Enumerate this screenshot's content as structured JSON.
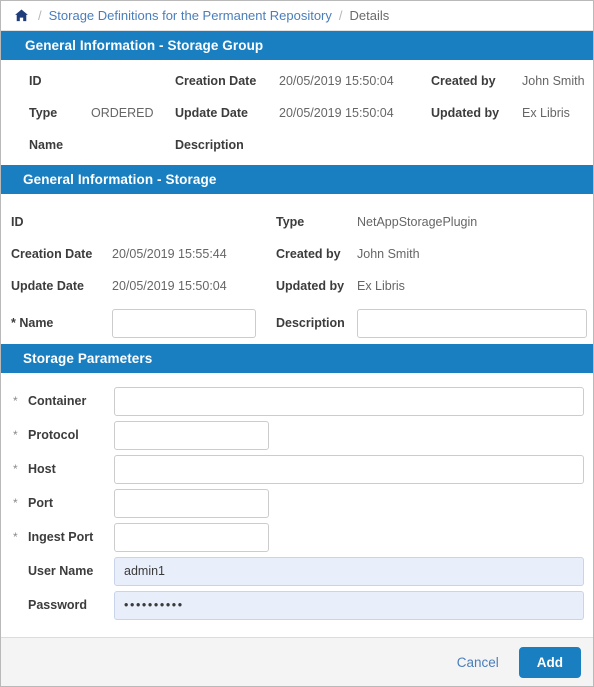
{
  "breadcrumb": {
    "home_icon": "home-icon",
    "separator": "/",
    "items": [
      {
        "label": "Storage Definitions for the Permanent Repository",
        "current": false
      },
      {
        "label": "Details",
        "current": true
      }
    ]
  },
  "colors": {
    "accent": "#1a7fc1",
    "link": "#4a7ebb",
    "filled_input_bg": "#e9eefb",
    "footer_bg": "#f4f4f4"
  },
  "sections": {
    "storage_group": {
      "title": "General Information - Storage Group",
      "rows": [
        {
          "col1_label": "ID",
          "col1_value": "",
          "col2_label": "Creation Date",
          "col2_value": "20/05/2019 15:50:04",
          "col3_label": "Created by",
          "col3_value": "John Smith"
        },
        {
          "col1_label": "Type",
          "col1_value": "ORDERED",
          "col2_label": "Update Date",
          "col2_value": "20/05/2019 15:50:04",
          "col3_label": "Updated by",
          "col3_value": "Ex Libris"
        },
        {
          "col1_label": "Name",
          "col1_value": "",
          "col2_label": "Description",
          "col2_value": "",
          "col3_label": "",
          "col3_value": ""
        }
      ]
    },
    "storage": {
      "title": "General Information - Storage",
      "rows": [
        {
          "left_label": "ID",
          "left_value": "",
          "right_label": "Type",
          "right_value": "NetAppStoragePlugin"
        },
        {
          "left_label": "Creation Date",
          "left_value": "20/05/2019 15:55:44",
          "right_label": "Created by",
          "right_value": "John Smith"
        },
        {
          "left_label": "Update Date",
          "left_value": "20/05/2019 15:50:04",
          "right_label": "Updated by",
          "right_value": "Ex Libris"
        }
      ],
      "name_field": {
        "label": "* Name",
        "value": "",
        "placeholder": ""
      },
      "description_field": {
        "label": "Description",
        "value": "",
        "placeholder": ""
      }
    },
    "storage_parameters": {
      "title": "Storage Parameters",
      "required_marker": "*",
      "fields": [
        {
          "label": "Container",
          "required": true,
          "value": "",
          "placeholder": "",
          "width": "full",
          "filled": false
        },
        {
          "label": "Protocol",
          "required": true,
          "value": "",
          "placeholder": "",
          "width": "short",
          "filled": false
        },
        {
          "label": "Host",
          "required": true,
          "value": "",
          "placeholder": "",
          "width": "full",
          "filled": false
        },
        {
          "label": "Port",
          "required": true,
          "value": "",
          "placeholder": "",
          "width": "short",
          "filled": false
        },
        {
          "label": "Ingest Port",
          "required": true,
          "value": "",
          "placeholder": "",
          "width": "short",
          "filled": false
        },
        {
          "label": "User Name",
          "required": false,
          "value": "admin1",
          "placeholder": "",
          "width": "full",
          "filled": true
        },
        {
          "label": "Password",
          "required": false,
          "value": "••••••••••",
          "placeholder": "",
          "width": "full",
          "filled": true,
          "masked": true
        }
      ]
    }
  },
  "footer": {
    "cancel_label": "Cancel",
    "add_label": "Add"
  }
}
